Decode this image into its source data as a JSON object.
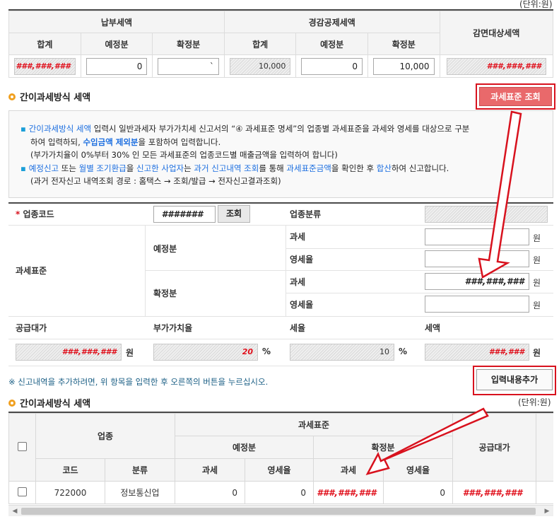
{
  "top": {
    "unit": "(단위:원)",
    "group1": "납부세액",
    "group2": "경감공제세액",
    "exempt": "감면대상세액",
    "col_total": "합계",
    "col_prelim": "예정분",
    "col_final": "확정분",
    "col_total2": "합계",
    "col_prelim2": "예정분",
    "col_final2": "확정분",
    "v_total": "###,###,###",
    "v_prelim": "0",
    "v_final": "`",
    "v_total2": "10,000",
    "v_prelim2": "0",
    "v_final2": "10,000",
    "v_exempt": "###,###,###"
  },
  "section1": {
    "title": "간이과세방식 세액",
    "lookup_btn": "과세표준 조회"
  },
  "notice": {
    "l1_a": "간이과세방식 세액",
    "l1_b": " 입력시 일반과세자 부가가치세 신고서의 “④ 과세표준 명세”의 업종별 과세표준을 과세와 영세를 대상으로 구분",
    "l2_a": "하여 입력하되, ",
    "l2_b": "수입금액 제외분",
    "l2_c": "을 포함하여 입력합니다.",
    "l3": "(부가가치율이 0%부터 30% 인 모든 과세표준의 업종코드별 매출금액을 입력하여 합니다)",
    "l4_a": "예정신고",
    "l4_b": " 또는 ",
    "l4_c": "월별 조기환급",
    "l4_d": "을 ",
    "l4_e": "신고한 사업자",
    "l4_f": "는 ",
    "l4_g": "과거 신고내역 조회",
    "l4_h": "를 통해 ",
    "l4_i": "과세표준금액",
    "l4_j": "을 확인한 후 ",
    "l4_k": "합산",
    "l4_l": "하여 신고합니다.",
    "l5": "(과거 전자신고 내역조회 경로 : 홈택스 → 조회/발급 → 전자신고결과조회)"
  },
  "form": {
    "required_mark": "*",
    "industry_code_label": "업종코드",
    "industry_code_value": "#######",
    "lookup_small": "조회",
    "industry_class_label": "업종분류",
    "tax_base_label": "과세표준",
    "prelim_label": "예정분",
    "final_label": "확정분",
    "taxable_label": "과세",
    "zero_label": "영세율",
    "final_taxable_value": "###,###,###",
    "won": "원",
    "supply_label": "공급대가",
    "vat_rate_label": "부가가치율",
    "tax_rate_label": "세율",
    "tax_amount_label": "세액",
    "supply_value": "###,###,###",
    "vat_rate_value": "20",
    "tax_rate_value": "10",
    "tax_amount_value": "###,###",
    "percent": "%"
  },
  "hint": "※ 신고내역을 추가하려면, 위 항목을 입력한 후 오른쪽의 버튼을 누르십시오.",
  "add_btn": "입력내용추가",
  "section2": {
    "title": "간이과세방식 세액",
    "unit": "(단위:원)"
  },
  "table2": {
    "h_industry": "업종",
    "h_tax_base": "과세표준",
    "h_prelim": "예정분",
    "h_final": "확정분",
    "h_supply": "공급대가",
    "h_code": "코드",
    "h_class": "분류",
    "h_taxable1": "과세",
    "h_zero1": "영세율",
    "h_taxable2": "과세",
    "h_zero2": "영세율",
    "row": {
      "code": "722000",
      "class": "정보통신업",
      "prelim_taxable": "0",
      "prelim_zero": "0",
      "final_taxable": "###,###,###",
      "final_zero": "0",
      "supply": "###,###,###"
    }
  },
  "colors": {
    "accent_red": "#d8121e",
    "button_pink": "#e9696b",
    "link_blue": "#1d6fe0",
    "bullet_orange": "#f0a020"
  }
}
